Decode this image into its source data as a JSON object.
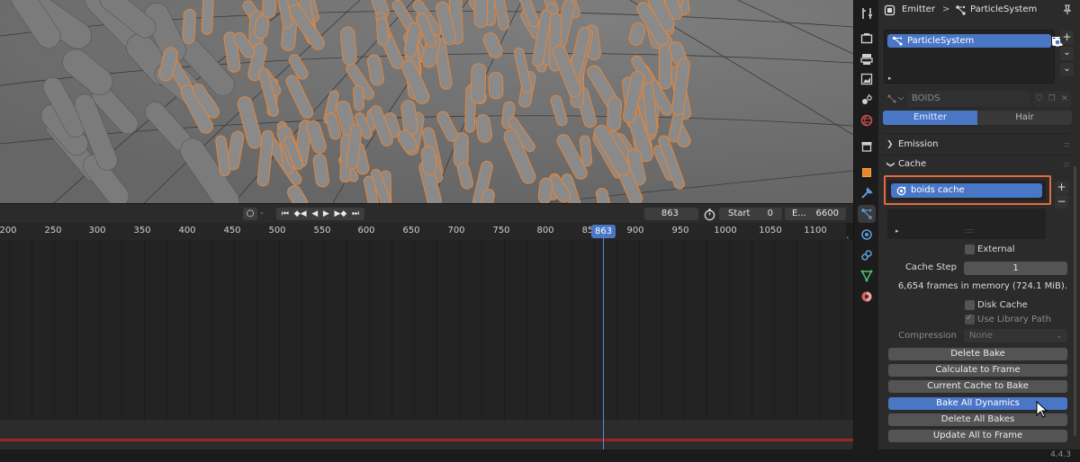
{
  "timeline": {
    "mode_glyph": "○",
    "mode_caret": "⌄",
    "transport_glyphs": [
      "⏮",
      "◆◀",
      "◀",
      "▶",
      "▶◆",
      "⏭"
    ],
    "current_frame": "863",
    "start_label": "Start",
    "start_value": "0",
    "end_label": "E...",
    "end_value": "6600",
    "ruler_ticks": [
      "200",
      "250",
      "300",
      "350",
      "400",
      "450",
      "500",
      "550",
      "600",
      "650",
      "700",
      "750",
      "800",
      "85",
      "900",
      "950",
      "1000",
      "1050",
      "1100"
    ],
    "playhead_badge": "863"
  },
  "properties": {
    "breadcrumb": {
      "object": "Emitter",
      "separator": ">",
      "system": "ParticleSystem"
    },
    "particle_list": {
      "items": [
        "ParticleSystem"
      ],
      "add_symbol": "+",
      "more_symbol": "⌄",
      "expand_symbol": "▸"
    },
    "settings_name": "BOIDS",
    "emit_from": {
      "options": [
        "Emitter",
        "Hair"
      ],
      "selected": "Emitter"
    },
    "panels": {
      "emission": "Emission",
      "cache": "Cache"
    },
    "cache": {
      "list_items": [
        "boids cache"
      ],
      "add_symbol": "+",
      "remove_symbol": "−",
      "expand_symbol": "▸",
      "grip": "::::",
      "external_label": "External",
      "cache_step_label": "Cache Step",
      "cache_step_value": "1",
      "memory_info": "6,654 frames in memory (724.1 MiB).",
      "disk_cache_label": "Disk Cache",
      "use_library_path_label": "Use Library Path",
      "compression_label": "Compression",
      "compression_value": "None",
      "buttons": {
        "delete_bake": "Delete Bake",
        "calculate_to_frame": "Calculate to Frame",
        "current_cache_to_bake": "Current Cache to Bake",
        "bake_all_dynamics": "Bake All Dynamics",
        "delete_all_bakes": "Delete All Bakes",
        "update_all_to_frame": "Update All to Frame"
      }
    }
  },
  "status": {
    "version": "4.4.3"
  },
  "colors": {
    "accent": "#4a76c6",
    "highlight_box": "#e56a3e",
    "selected_outline": "#e0853c"
  }
}
